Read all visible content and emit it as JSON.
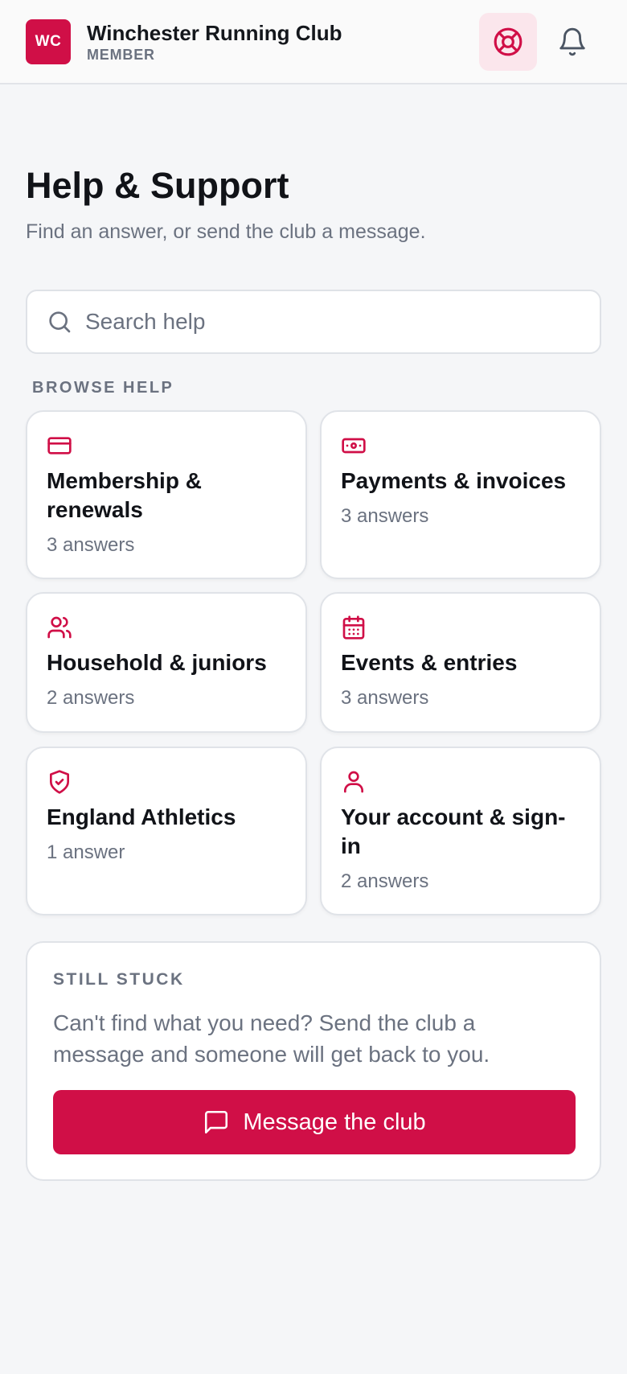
{
  "header": {
    "logo_text": "WC",
    "club_name": "Winchester Running Club",
    "role": "MEMBER",
    "help_icon": "lifebuoy-icon",
    "notifications_icon": "bell-icon"
  },
  "page": {
    "title": "Help & Support",
    "subtitle": "Find an answer, or send the club a message."
  },
  "search": {
    "placeholder": "Search help",
    "value": ""
  },
  "browse": {
    "label": "BROWSE HELP",
    "categories": [
      {
        "title": "Membership & renewals",
        "count": "3 answers",
        "icon": "credit-card-icon"
      },
      {
        "title": "Payments & invoices",
        "count": "3 answers",
        "icon": "banknote-icon"
      },
      {
        "title": "Household & juniors",
        "count": "2 answers",
        "icon": "users-icon"
      },
      {
        "title": "Events & entries",
        "count": "3 answers",
        "icon": "calendar-icon"
      },
      {
        "title": "England Athletics",
        "count": "1 answer",
        "icon": "shield-check-icon"
      },
      {
        "title": "Your account & sign-in",
        "count": "2 answers",
        "icon": "user-icon"
      }
    ]
  },
  "stuck": {
    "label": "STILL STUCK",
    "text": "Can't find what you need? Send the club a message and someone will get back to you.",
    "button_label": "Message the club",
    "button_icon": "message-square-icon"
  },
  "colors": {
    "accent": "#d00f47",
    "accent_soft": "#fbe6ec",
    "muted_text": "#6b7280",
    "background": "#f5f6f8"
  }
}
